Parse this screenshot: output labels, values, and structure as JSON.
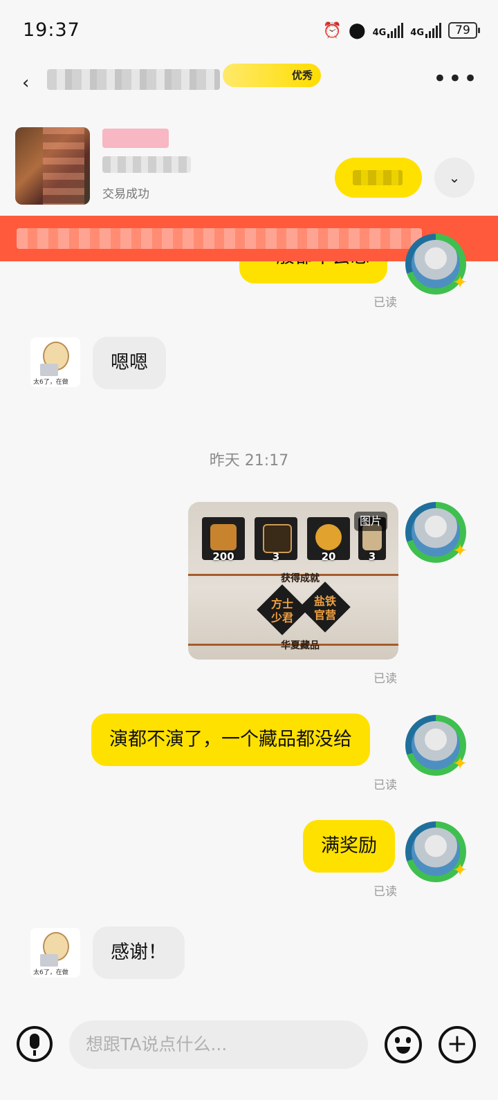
{
  "status_bar": {
    "time": "19:37",
    "network1": "4G",
    "network2": "4G",
    "battery": "79"
  },
  "header": {
    "badge_text": "优秀"
  },
  "order": {
    "status": "交易成功"
  },
  "messages": [
    {
      "side": "right",
      "text": "一般都不会忘",
      "read": "已读"
    },
    {
      "side": "left",
      "text": "嗯嗯"
    },
    {
      "side": "right",
      "type": "image",
      "image_tag": "图片",
      "read": "已读",
      "image_texts": {
        "tile1": "200",
        "tile2": "3",
        "tile3": "20",
        "tile4": "3",
        "achieve": "获得成就",
        "d1a": "方士",
        "d1b": "少君",
        "d2a": "盐铁",
        "d2b": "官营",
        "collect": "华夏藏品"
      }
    },
    {
      "side": "right",
      "text": "演都不演了，一个藏品都没给",
      "read": "已读"
    },
    {
      "side": "right",
      "text": "满奖励",
      "read": "已读"
    },
    {
      "side": "left",
      "text": "感谢！"
    }
  ],
  "time_divider": "昨天 21:17",
  "avatar_other_caption": "太6了，在做",
  "composer": {
    "placeholder": "想跟TA说点什么..."
  },
  "colors": {
    "accent_yellow": "#ffe100",
    "notice_red": "#ff5a3b"
  }
}
